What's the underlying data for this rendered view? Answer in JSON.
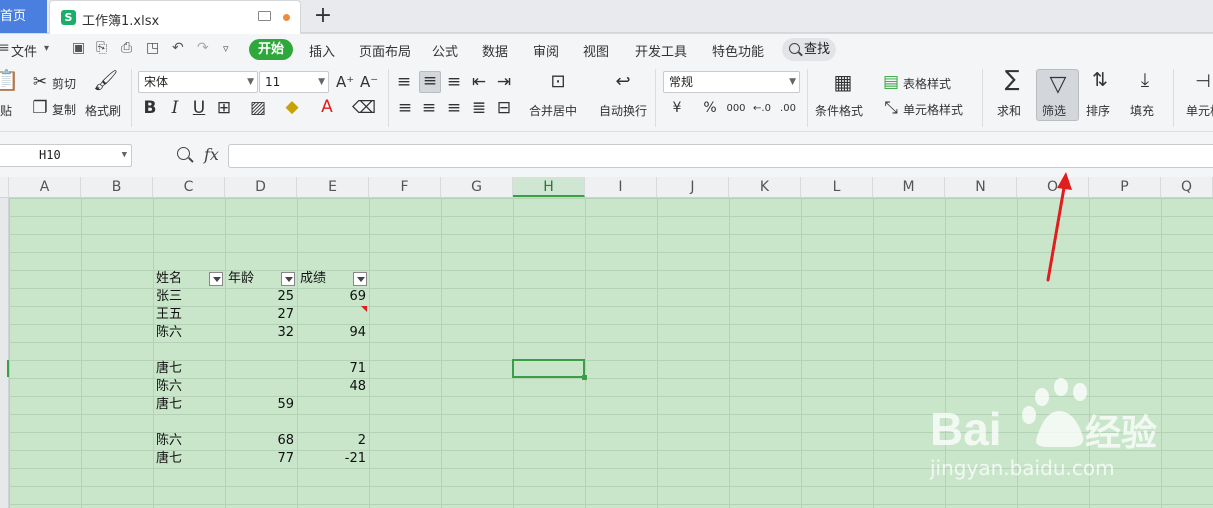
{
  "tabs": {
    "home": "首页",
    "file": "工作簿1.xlsx",
    "new_tab": "+"
  },
  "menu": {
    "file": "文件",
    "start": "开始",
    "items": [
      "插入",
      "页面布局",
      "公式",
      "数据",
      "审阅",
      "视图",
      "开发工具",
      "特色功能"
    ],
    "search": "查找"
  },
  "ribbon": {
    "paste": "贴",
    "cut": "剪切",
    "copy": "复制",
    "format_painter": "格式刷",
    "font_name": "宋体",
    "font_size": "11",
    "bold": "B",
    "italic": "I",
    "underline": "U",
    "merge_center": "合并居中",
    "wrap_text": "自动换行",
    "number_format": "常规",
    "currency": "¥",
    "percent": "%",
    "thousands": "000",
    "conditional_format": "条件格式",
    "table_style": "表格样式",
    "cell_style": "单元格样式",
    "sum": "求和",
    "filter": "筛选",
    "sort": "排序",
    "fill": "填充",
    "cell": "单元格"
  },
  "formula_bar": {
    "name_box": "H10",
    "fx": "fx",
    "formula": ""
  },
  "columns": [
    "A",
    "B",
    "C",
    "D",
    "E",
    "F",
    "G",
    "H",
    "I",
    "J",
    "K",
    "L",
    "M",
    "N",
    "O",
    "P",
    "Q"
  ],
  "selected_column": "H",
  "table": {
    "headers": [
      "姓名",
      "年龄",
      "成绩"
    ],
    "rows": [
      [
        "张三",
        "25",
        "69"
      ],
      [
        "王五",
        "27",
        ""
      ],
      [
        "陈六",
        "32",
        "94"
      ],
      [
        "",
        "",
        ""
      ],
      [
        "唐七",
        "",
        "71"
      ],
      [
        "陈六",
        "",
        "48"
      ],
      [
        "唐七",
        "59",
        ""
      ],
      [
        "",
        "",
        ""
      ],
      [
        "陈六",
        "68",
        "2"
      ],
      [
        "唐七",
        "77",
        "-21"
      ]
    ]
  },
  "colors": {
    "accent_green": "#2fa83b",
    "sheet_bg": "#c9e6cb",
    "annotation_red": "#e21d1d",
    "home_tab": "#4a7fe0"
  },
  "watermark": {
    "brand": "Baidu经验",
    "url": "jingyan.baidu.com"
  }
}
